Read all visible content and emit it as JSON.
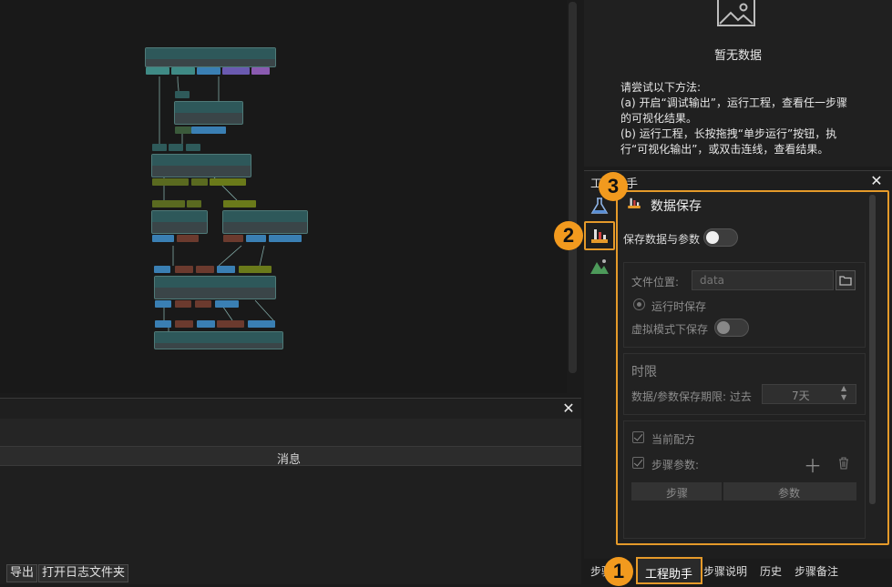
{
  "preview": {
    "empty_text": "暂无数据",
    "hint_lines": [
      "请尝试以下方法:",
      "(a) 开启“调试输出”，运行工程，查看任一步骤",
      "的可视化结果。",
      "(b) 运行工程，长按拖拽“单步运行”按钮，执",
      "行“可视化输出”，或双击连线，查看结果。"
    ]
  },
  "log": {
    "column_header": "消息",
    "export_label": "导出",
    "open_folder_label": "打开日志文件夹"
  },
  "assistant": {
    "title": "工程助手",
    "section_title": "数据保存",
    "save_toggle_label": "保存数据与参数",
    "file_location_label": "文件位置:",
    "file_location_placeholder": "data",
    "save_on_run_label": "运行时保存",
    "virtual_mode_label": "虚拟模式下保存",
    "time_limit_title": "时限",
    "retention_label": "数据/参数保存期限: 过去",
    "retention_value": "7天",
    "current_recipe_label": "当前配方",
    "step_params_label": "步骤参数:",
    "table_headers": [
      "步骤",
      "参数"
    ]
  },
  "tabs": [
    "步骤",
    "工程助手",
    "步骤说明",
    "历史",
    "步骤备注"
  ],
  "callouts": [
    "1",
    "2",
    "3"
  ],
  "colors": {
    "accent": "#e59a2a",
    "node_header": "#2e585a"
  }
}
